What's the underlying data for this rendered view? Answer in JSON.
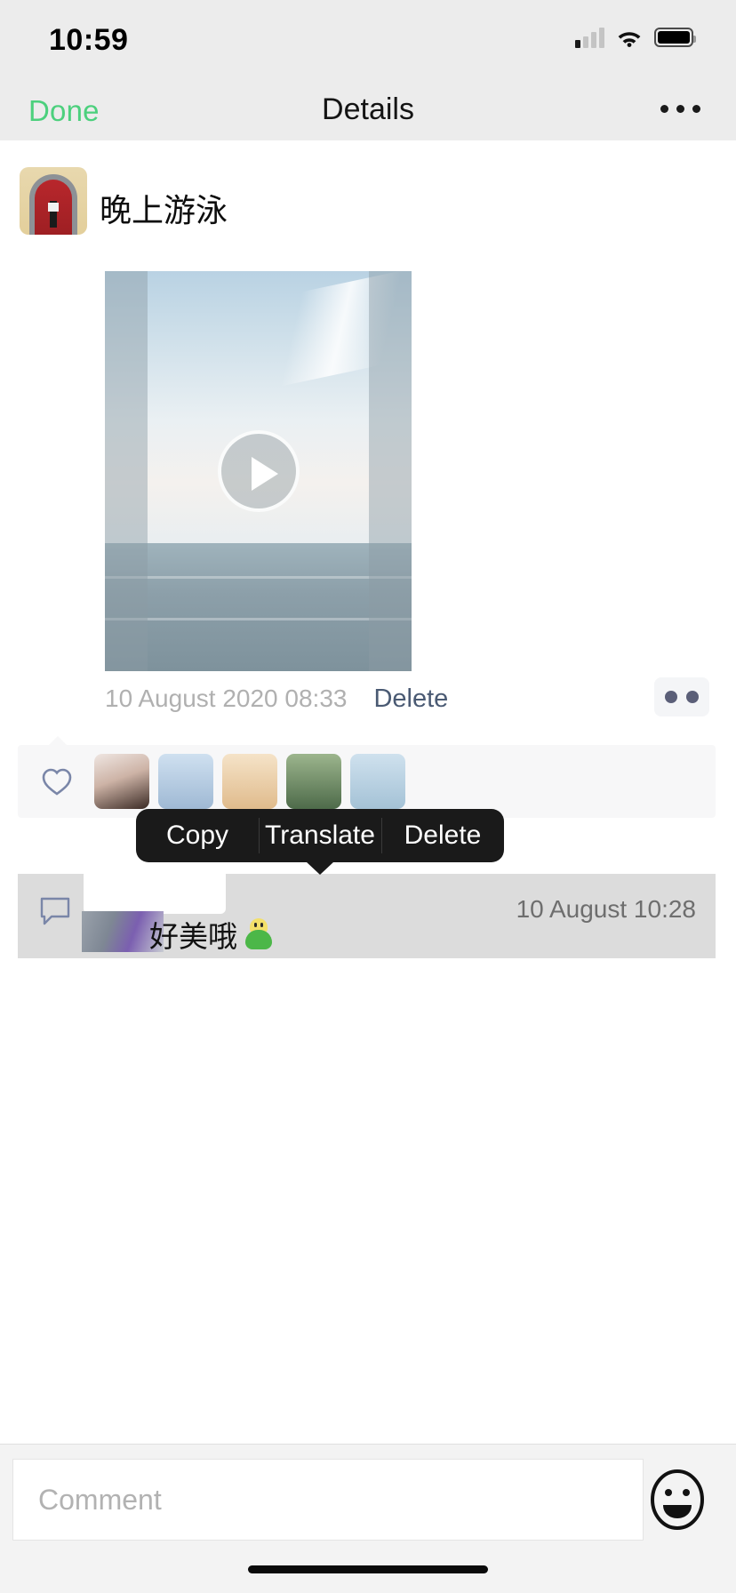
{
  "status_bar": {
    "time": "10:59",
    "signal_icon": "cellular-signal-icon",
    "wifi_icon": "wifi-icon",
    "battery_icon": "battery-icon"
  },
  "nav": {
    "done_label": "Done",
    "title": "Details",
    "more_icon": "ellipsis-icon"
  },
  "post": {
    "avatar_icon": "user-avatar",
    "author_name": "晚上游泳",
    "media": {
      "type": "video-thumbnail",
      "play_icon": "play-icon",
      "watermark": ""
    },
    "date": "10 August 2020 08:33",
    "delete_label": "Delete",
    "more_button_icon": "two-dots-icon"
  },
  "likes": {
    "heart_icon": "heart-outline-icon",
    "avatar_count": 5
  },
  "context_menu": {
    "items": [
      {
        "label": "Copy",
        "name": "copy"
      },
      {
        "label": "Translate",
        "name": "translate"
      },
      {
        "label": "Delete",
        "name": "delete"
      }
    ]
  },
  "comment": {
    "bubble_icon": "comment-bubble-icon",
    "text": "好美哦",
    "emoji": "qq-green-emoji",
    "time": "10 August  10:28",
    "selected": true
  },
  "bottom_bar": {
    "comment_placeholder": "Comment",
    "comment_value": "",
    "emoji_icon": "smiley-face-icon"
  },
  "colors": {
    "accent_green": "#4cd07d",
    "menu_background": "#1a1a1a",
    "selected_row": "#dcdcdc",
    "chrome": "#ececec"
  }
}
